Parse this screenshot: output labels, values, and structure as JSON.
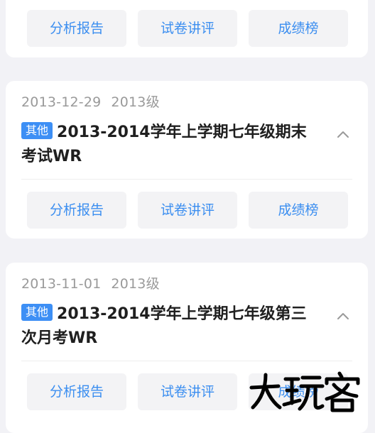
{
  "buttons": {
    "analysis": "分析报告",
    "lecture": "试卷讲评",
    "ranking": "成绩榜"
  },
  "exams": [
    {
      "date": "2013-12-29",
      "grade": "2013级",
      "tag": "其他",
      "title": "2013-2014学年上学期七年级期末考试WR"
    },
    {
      "date": "2013-11-01",
      "grade": "2013级",
      "tag": "其他",
      "title": "2013-2014学年上学期七年级第三次月考WR"
    }
  ],
  "icons": {
    "collapse": "chevron-up-icon"
  },
  "colors": {
    "accent": "#3b8ef0",
    "tag": "#3d8ff5",
    "background": "#f2f2f6"
  },
  "watermark": {
    "logo_text": "大玩客"
  }
}
